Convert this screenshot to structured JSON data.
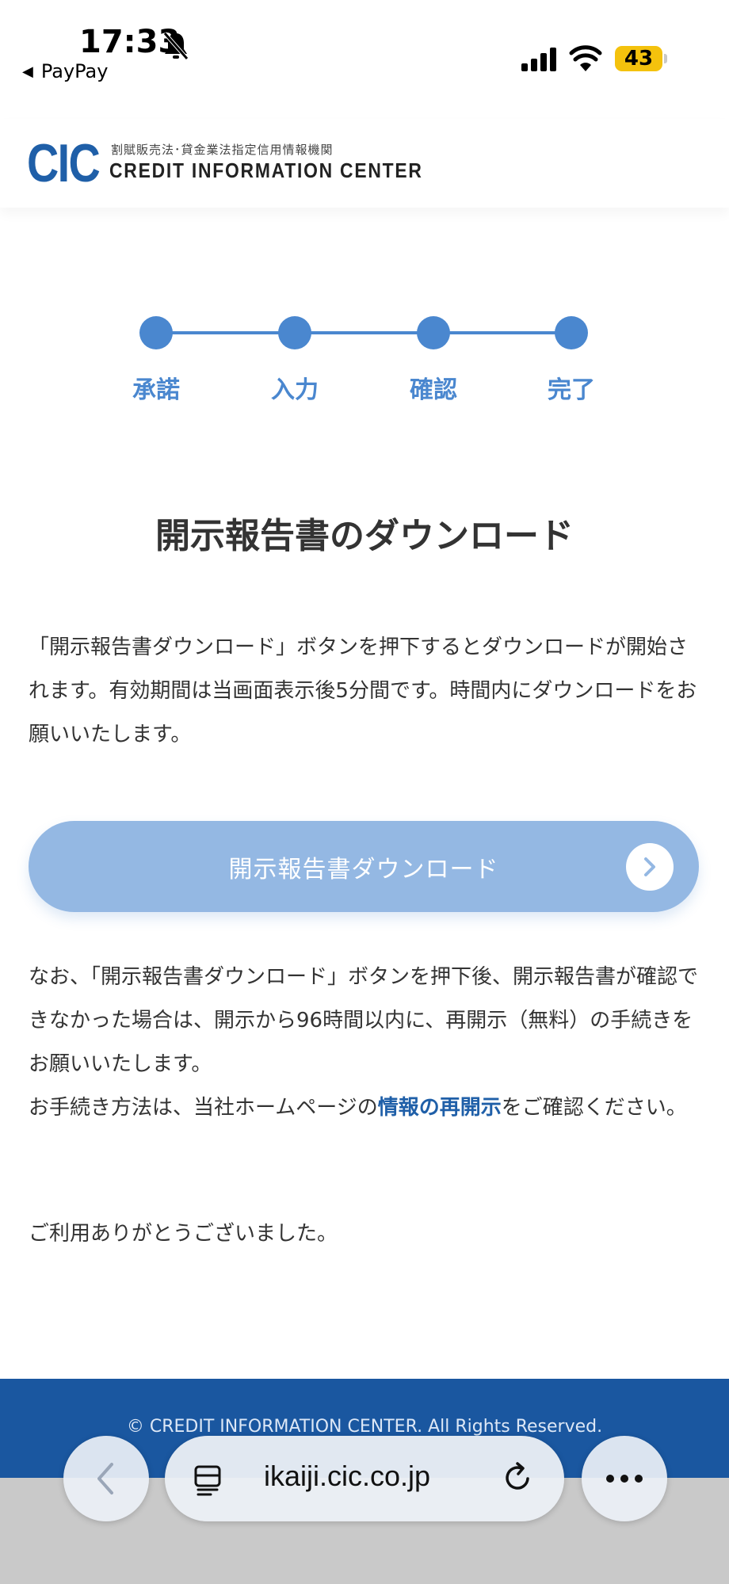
{
  "status_bar": {
    "time": "17:33",
    "back_app": "PayPay",
    "battery": "43"
  },
  "header": {
    "logo": "CIC",
    "logo_sub": "割賦販売法･貸金業法指定信用情報機関",
    "logo_main": "CREDIT INFORMATION CENTER"
  },
  "steps": [
    {
      "label": "承諾"
    },
    {
      "label": "入力"
    },
    {
      "label": "確認"
    },
    {
      "label": "完了"
    }
  ],
  "main": {
    "title": "開示報告書のダウンロード",
    "intro": "「開示報告書ダウンロード」ボタンを押下するとダウンロードが開始されます。有効期間は当画面表示後5分間です。時間内にダウンロードをお願いいたします。",
    "download_button": "開示報告書ダウンロード",
    "note_1": "なお、「開示報告書ダウンロード」ボタンを押下後、開示報告書が確認できなかった場合は、開示から96時間以内に、再開示（無料）の手続きをお願いいたします。",
    "note_2_before": "お手続き方法は、当社ホームページの",
    "note_2_link": "情報の再開示",
    "note_2_after": "をご確認ください。",
    "thanks": "ご利用ありがとうございました。"
  },
  "footer": {
    "copyright": "© CREDIT INFORMATION CENTER. All Rights Reserved."
  },
  "browser": {
    "url": "ikaiji.cic.co.jp"
  },
  "colors": {
    "accent": "#4a87cf",
    "button": "#94b8e3",
    "footer": "#1a57a0",
    "link": "#1f5fa8"
  }
}
